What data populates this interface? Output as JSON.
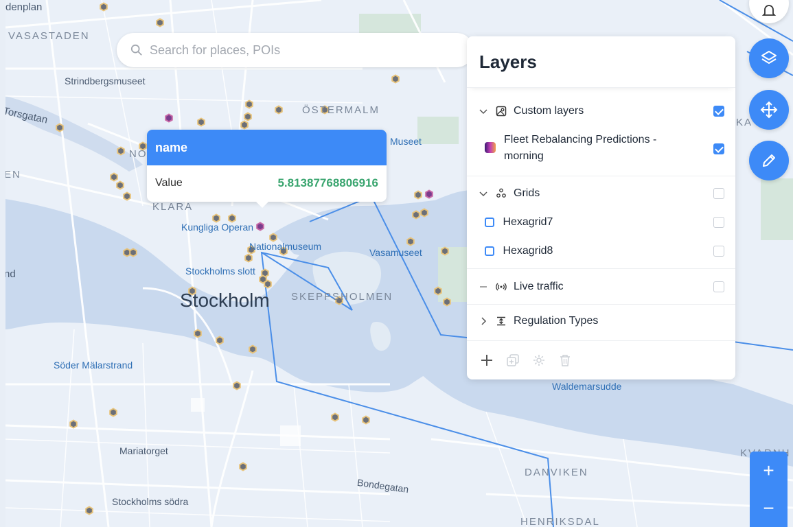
{
  "search": {
    "placeholder": "Search for places, POIs"
  },
  "map_labels": {
    "denplan": "denplan",
    "vasastaden": "VASASTADEN",
    "strindbergsmuseet": "Strindbergsmuseet",
    "torsgatan": "Torsgatan",
    "ostermalm": "ÖSTERMALM",
    "museet": "Museet",
    "nor": "NOR",
    "en": "EN",
    "klara": "KLARA",
    "kungliga_operan": "Kungliga Operan",
    "nationalmuseum": "Nationalmuseum",
    "vasamuseet": "Vasamuseet",
    "nd": "nd",
    "stockholms_slott": "Stockholms slott",
    "stockholm": "Stockholm",
    "skeppsholmen": "SKEPPSHOLMEN",
    "soder_malarstrand": "Söder Mälarstrand",
    "mariatorget": "Mariatorget",
    "bondegatan": "Bondegatan",
    "stockholms_sodra": "Stockholms södra",
    "danviken": "DANVIKEN",
    "henriksdal": "HENRIKSDAL",
    "waldemarsudde": "Waldemarsudde",
    "karlaplan": "KA",
    "kvarnh": "KVARNH"
  },
  "popup": {
    "title": "name",
    "field": "Value",
    "value": "5.81387768806916"
  },
  "layers_panel": {
    "title": "Layers",
    "groups": [
      {
        "label": "Custom layers",
        "checked": true,
        "items": [
          {
            "label_line1": "Fleet Rebalancing Predictions -",
            "label_line2": "morning",
            "checked": true
          }
        ]
      },
      {
        "label": "Grids",
        "checked": false,
        "items": [
          {
            "label": "Hexagrid7",
            "checked": false
          },
          {
            "label": "Hexagrid8",
            "checked": false
          }
        ]
      },
      {
        "label": "Live traffic",
        "checked": false
      },
      {
        "label": "Regulation Types"
      }
    ]
  },
  "controls": {
    "zoom_in": "+",
    "zoom_out": "−"
  },
  "colors": {
    "accent": "#3d8af7",
    "water": "#c9d9ee",
    "land": "#eaf0f8"
  }
}
